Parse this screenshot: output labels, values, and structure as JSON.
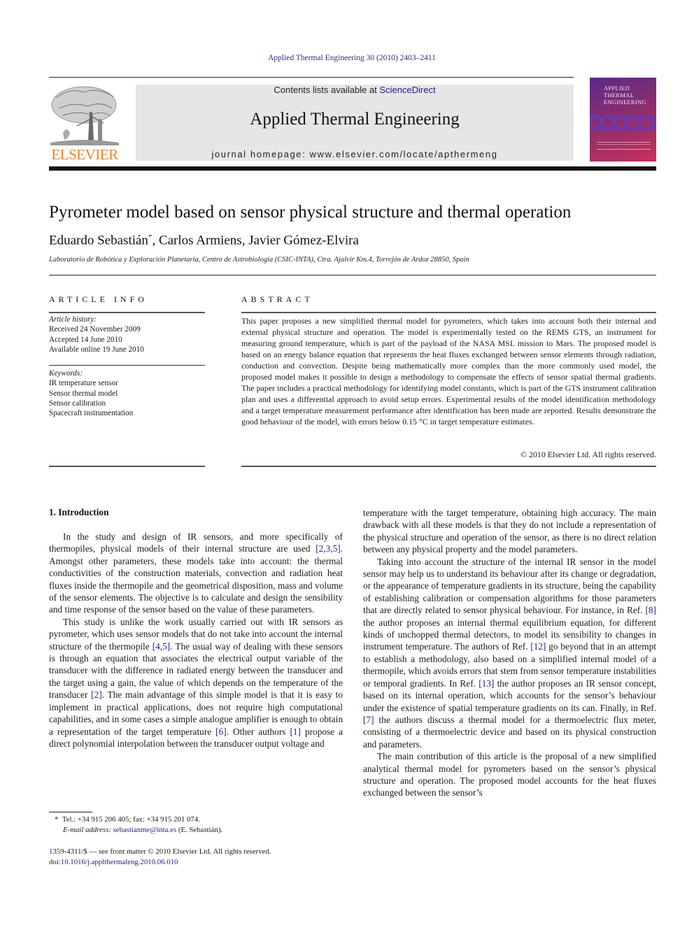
{
  "header": {
    "citation": "Applied Thermal Engineering 30 (2010) 2403–2411",
    "publisher_logo_text": "ELSEVIER",
    "contents_prefix": "Contents lists available at ",
    "contents_link": "ScienceDirect",
    "journal_title": "Applied Thermal Engineering",
    "homepage_prefix": "journal homepage: ",
    "homepage_url": "www.elsevier.com/locate/apthermeng",
    "cover": {
      "title_lines": [
        "Applied",
        "Thermal",
        "Engineering"
      ]
    }
  },
  "article": {
    "title": "Pyrometer model based on sensor physical structure and thermal operation",
    "authors": [
      {
        "name": "Eduardo Sebastián",
        "mark": "*"
      },
      {
        "name": "Carlos Armiens"
      },
      {
        "name": "Javier Gómez-Elvira"
      }
    ],
    "affiliation": "Laboratorio de Robótica y Exploración Planetaria, Centro de Astrobiología (CSIC-INTA), Ctra. Ajalvir Km.4, Torrejón de Ardoz 28850, Spain"
  },
  "article_info": {
    "heading": "ARTICLE INFO",
    "history_label": "Article history:",
    "history": [
      "Received 24 November 2009",
      "Accepted 14 June 2010",
      "Available online 19 June 2010"
    ],
    "keywords_label": "Keywords:",
    "keywords": [
      "IR temperature sensor",
      "Sensor thermal model",
      "Sensor calibration",
      "Spacecraft instrumentation"
    ]
  },
  "abstract": {
    "heading": "ABSTRACT",
    "text": "This paper proposes a new simplified thermal model for pyrometers, which takes into account both their internal and external physical structure and operation. The model is experimentally tested on the REMS GTS, an instrument for measuring ground temperature, which is part of the payload of the NASA MSL mission to Mars. The proposed model is based on an energy balance equation that represents the heat fluxes exchanged between sensor elements through radiation, conduction and convection. Despite being mathematically more complex than the more commonly used model, the proposed model makes it possible to design a methodology to compensate the effects of sensor spatial thermal gradients. The paper includes a practical methodology for identifying model constants, which is part of the GTS instrument calibration plan and uses a differential approach to avoid setup errors. Experimental results of the model identification methodology and a target temperature measurement performance after identification has been made are reported. Results demonstrate the good behaviour of the model, with errors below 0.15 °C in target temperature estimates.",
    "copyright": "© 2010 Elsevier Ltd. All rights reserved."
  },
  "body": {
    "section_heading": "1.  Introduction",
    "left_column": [
      [
        {
          "t": "In the study and design of IR sensors, and more specifically of thermopiles, physical models of their internal structure are used "
        },
        {
          "ref": "[2,3,5]"
        },
        {
          "t": ". Amongst other parameters, these models take into account: the thermal conductivities of the construction materials, convection and radiation heat fluxes inside the thermopile and the geometrical disposition, mass and volume of the sensor elements. The objective is to calculate and design the sensibility and time response of the sensor based on the value of these parameters."
        }
      ],
      [
        {
          "t": "This study is unlike the work usually carried out with IR sensors as pyrometer, which uses sensor models that do not take into account the internal structure of the thermopile "
        },
        {
          "ref": "[4,5]"
        },
        {
          "t": ". The usual way of dealing with these sensors is through an equation that associates the electrical output variable of the transducer with the difference in radiated energy between the transducer and the target using a gain, the value of which depends on the temperature of the transducer "
        },
        {
          "ref": "[2]"
        },
        {
          "t": ". The main advantage of this simple model is that it is easy to implement in practical applications, does not require high computational capabilities, and in some cases a simple analogue amplifier is enough to obtain a representation of the target temperature "
        },
        {
          "ref": "[6]"
        },
        {
          "t": ". Other authors "
        },
        {
          "ref": "[1]"
        },
        {
          "t": " propose a direct polynomial interpolation between the transducer output voltage and"
        }
      ]
    ],
    "right_column": [
      [
        {
          "t": "temperature with the target temperature, obtaining high accuracy. The main drawback with all these models is that they do not include a representation of the physical structure and operation of the sensor, as there is no direct relation between any physical property and the model parameters."
        }
      ],
      [
        {
          "t": "Taking into account the structure of the internal IR sensor in the model sensor may help us to understand its behaviour after its change or degradation, or the appearance of temperature gradients in its structure, being the capability of establishing calibration or compensation algorithms for those parameters that are directly related to sensor physical behaviour. For instance, in Ref. "
        },
        {
          "ref": "[8]"
        },
        {
          "t": " the author proposes an internal thermal equilibrium equation, for different kinds of unchopped thermal detectors, to model its sensibility to changes in instrument temperature. The authors of Ref. "
        },
        {
          "ref": "[12]"
        },
        {
          "t": " go beyond that in an attempt to establish a methodology, also based on a simplified internal model of a thermopile, which avoids errors that stem from sensor temperature instabilities or temporal gradients. In Ref. "
        },
        {
          "ref": "[13]"
        },
        {
          "t": " the author proposes an IR sensor concept, based on its internal operation, which accounts for the sensor’s behaviour under the existence of spatial temperature gradients on its can. Finally, in Ref. "
        },
        {
          "ref": "[7]"
        },
        {
          "t": " the authors discuss a thermal model for a thermoelectric flux meter, consisting of a thermoelectric device and based on its physical construction and parameters."
        }
      ],
      [
        {
          "t": "The main contribution of this article is the proposal of a new simplified analytical thermal model for pyrometers based on the sensor’s physical structure and operation. The proposed model accounts for the heat fluxes exchanged between the sensor’s"
        }
      ]
    ]
  },
  "footnote": {
    "marker": "*",
    "contact": "Tel.: +34 915 206 405; fax: +34 915 201 074.",
    "email_label": "E-mail address: ",
    "email": "sebastianme@inta.es",
    "email_suffix": " (E. Sebastián)."
  },
  "front_matter": {
    "issn_line": "1359-4311/$ — see front matter © 2010 Elsevier Ltd. All rights reserved.",
    "doi_label": "doi:",
    "doi": "10.1016/j.applthermaleng.2010.06.010"
  },
  "colors": {
    "link": "#1d1d8f",
    "elsevier_orange": "#f0821e",
    "masthead_gray": "#e6e6e6"
  }
}
